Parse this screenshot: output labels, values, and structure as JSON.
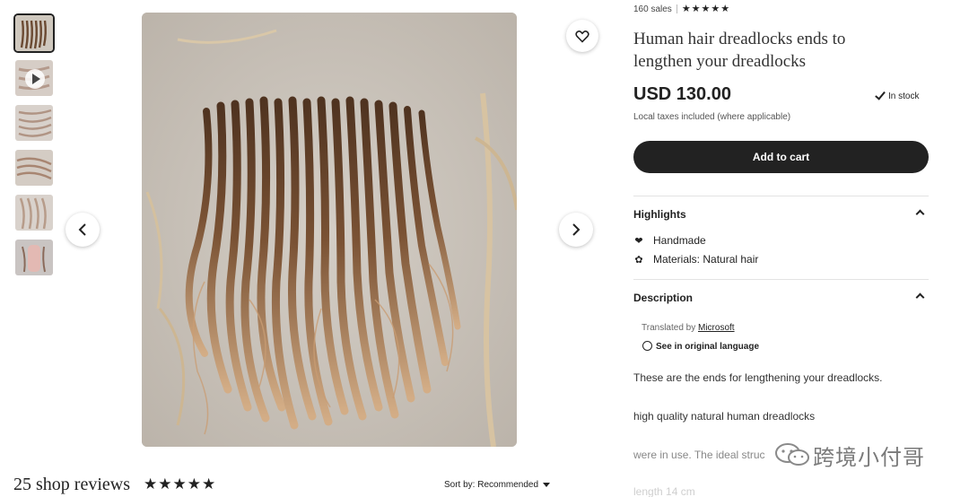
{
  "thumbnails": [
    {
      "kind": "image",
      "active": true
    },
    {
      "kind": "video",
      "active": false
    },
    {
      "kind": "image",
      "active": false
    },
    {
      "kind": "image",
      "active": false
    },
    {
      "kind": "image",
      "active": false
    },
    {
      "kind": "image",
      "active": false
    }
  ],
  "listing": {
    "sales": "160 sales",
    "rating_stars": "★★★★★",
    "title": "Human hair dreadlocks ends to lengthen your dreadlocks",
    "price": "USD 130.00",
    "stock": "In stock",
    "taxes": "Local taxes included (where applicable)",
    "add_to_cart": "Add to cart"
  },
  "highlights": {
    "heading": "Highlights",
    "items": [
      {
        "icon": "handmade-icon",
        "label": "Handmade"
      },
      {
        "icon": "materials-icon",
        "label": "Materials: Natural hair"
      }
    ]
  },
  "description": {
    "heading": "Description",
    "translated_prefix": "Translated by ",
    "translator": "Microsoft",
    "see_original": "See in original language",
    "paragraphs": [
      "These are the ends for lengthening your dreadlocks.",
      "high quality natural human dreadlocks",
      "were in use. The ideal struc",
      "length 14 cm"
    ]
  },
  "reviews": {
    "title": "25 shop reviews",
    "stars": "★★★★★",
    "sort_label": "Sort by: Recommended"
  },
  "watermark": {
    "text": "跨境小付哥"
  },
  "colors": {
    "primary_button": "#222222",
    "background": "#ffffff",
    "hair_dark": "#5a3b26",
    "hair_light": "#c59a72",
    "backdrop": "#c9c2b8"
  }
}
